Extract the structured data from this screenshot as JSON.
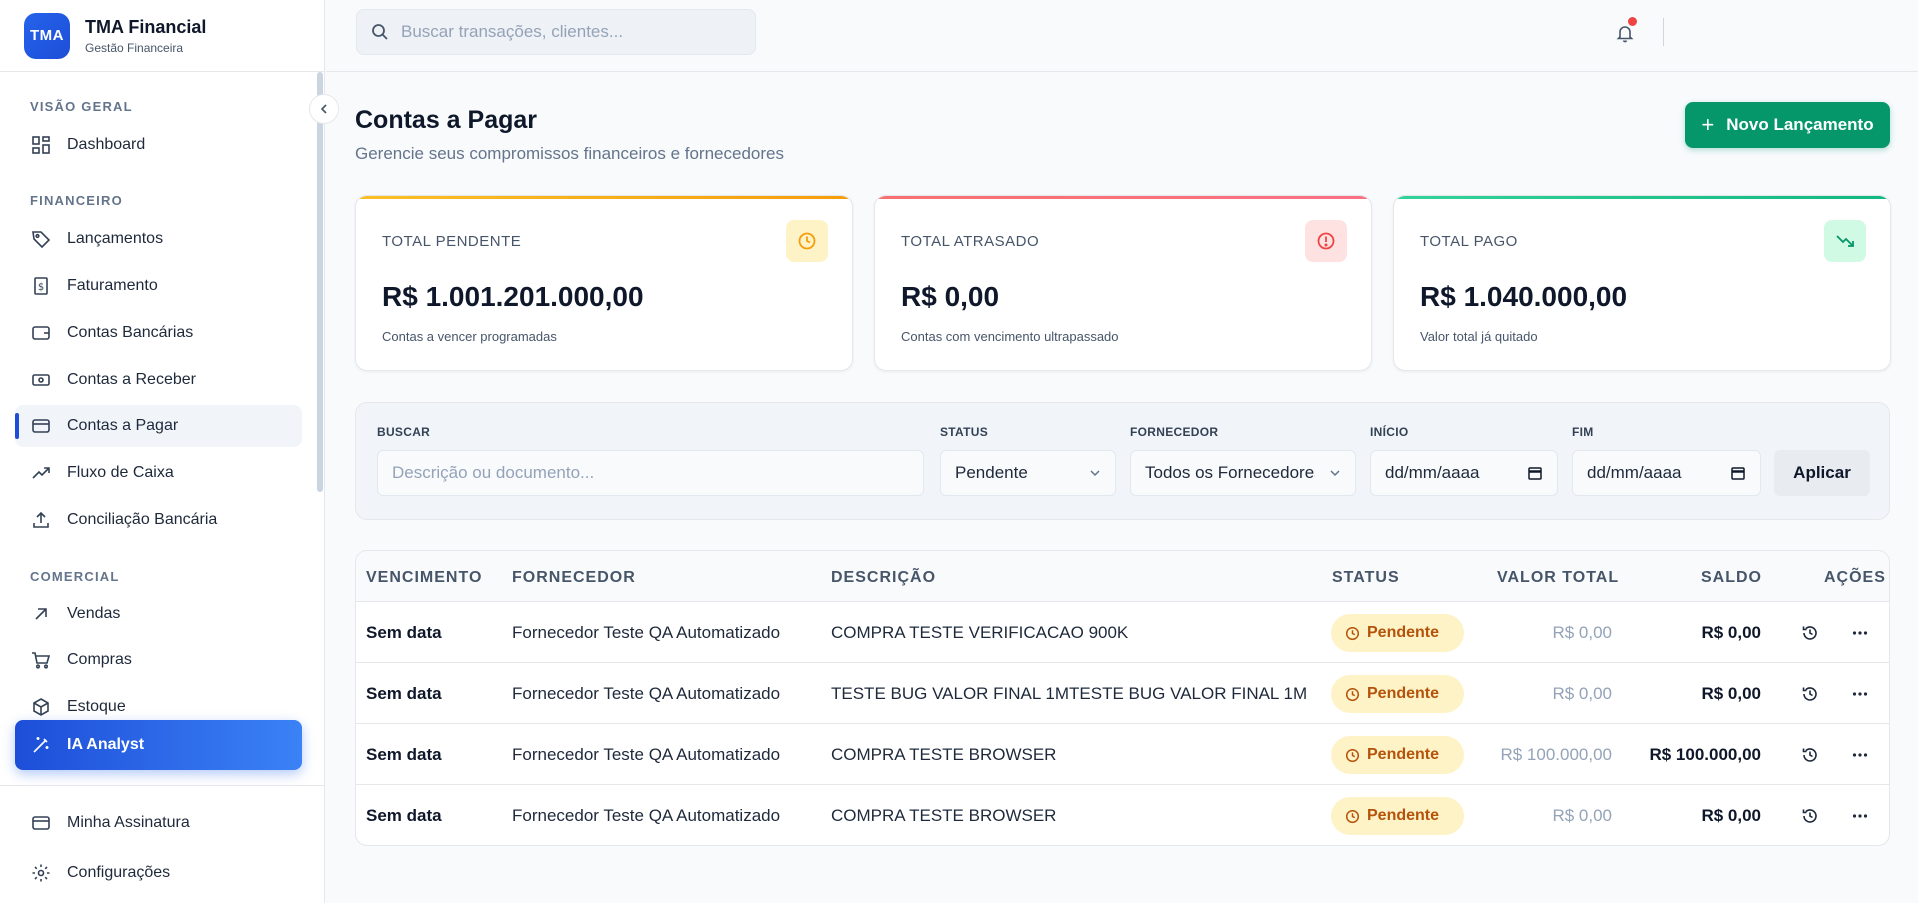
{
  "brand": {
    "logo": "TMA",
    "name": "TMA Financial",
    "subtitle": "Gestão Financeira"
  },
  "sidebar": {
    "sections": [
      {
        "label": "VISÃO GERAL"
      },
      {
        "label": "FINANCEIRO"
      },
      {
        "label": "COMERCIAL"
      }
    ],
    "items": [
      {
        "label": "Dashboard",
        "icon": "dashboard-icon"
      },
      {
        "label": "Lançamentos",
        "icon": "tag-icon"
      },
      {
        "label": "Faturamento",
        "icon": "invoice-icon"
      },
      {
        "label": "Contas Bancárias",
        "icon": "wallet-icon"
      },
      {
        "label": "Contas a Receber",
        "icon": "banknote-icon"
      },
      {
        "label": "Contas a Pagar",
        "icon": "credit-card-icon",
        "active": true
      },
      {
        "label": "Fluxo de Caixa",
        "icon": "trend-up-icon"
      },
      {
        "label": "Conciliação Bancária",
        "icon": "upload-icon"
      },
      {
        "label": "Vendas",
        "icon": "arrow-up-right-icon"
      },
      {
        "label": "Compras",
        "icon": "cart-icon"
      },
      {
        "label": "Estoque",
        "icon": "box-icon"
      },
      {
        "label": "IA Analyst",
        "icon": "magic-wand-icon"
      },
      {
        "label": "Minha Assinatura",
        "icon": "card-icon"
      },
      {
        "label": "Configurações",
        "icon": "gear-icon"
      }
    ]
  },
  "header": {
    "search_placeholder": "Buscar transações, clientes..."
  },
  "page": {
    "title": "Contas a Pagar",
    "subtitle": "Gerencie seus compromissos financeiros e fornecedores",
    "new_button": "Novo Lançamento"
  },
  "cards": [
    {
      "title": "TOTAL PENDENTE",
      "value": "R$ 1.001.201.000,00",
      "desc": "Contas a vencer programadas",
      "color": "#f59e0b"
    },
    {
      "title": "TOTAL ATRASADO",
      "value": "R$ 0,00",
      "desc": "Contas com vencimento ultrapassado",
      "color": "#ef4444"
    },
    {
      "title": "TOTAL PAGO",
      "value": "R$ 1.040.000,00",
      "desc": "Valor total já quitado",
      "color": "#10b981"
    }
  ],
  "filters": {
    "search_label": "BUSCAR",
    "search_placeholder": "Descrição ou documento...",
    "status_label": "STATUS",
    "status_value": "Pendente",
    "supplier_label": "FORNECEDOR",
    "supplier_value": "Todos os Fornecedores",
    "start_label": "INÍCIO",
    "start_value": "dd/mm/aaaa",
    "end_label": "FIM",
    "end_value": "dd/mm/aaaa",
    "apply": "Aplicar"
  },
  "table": {
    "headers": [
      "VENCIMENTO",
      "FORNECEDOR",
      "DESCRIÇÃO",
      "STATUS",
      "VALOR TOTAL",
      "SALDO",
      "AÇÕES"
    ],
    "rows": [
      {
        "due": "Sem data",
        "supplier": "Fornecedor Teste QA Automatizado",
        "description": "COMPRA TESTE VERIFICACAO 900K",
        "status": "Pendente",
        "total": "R$ 0,00",
        "balance": "R$ 0,00"
      },
      {
        "due": "Sem data",
        "supplier": "Fornecedor Teste QA Automatizado",
        "description": "TESTE BUG VALOR FINAL 1MTESTE BUG VALOR FINAL 1M",
        "status": "Pendente",
        "total": "R$ 0,00",
        "balance": "R$ 0,00"
      },
      {
        "due": "Sem data",
        "supplier": "Fornecedor Teste QA Automatizado",
        "description": "COMPRA TESTE BROWSER",
        "status": "Pendente",
        "total": "R$ 100.000,00",
        "balance": "R$ 100.000,00"
      },
      {
        "due": "Sem data",
        "supplier": "Fornecedor Teste QA Automatizado",
        "description": "COMPRA TESTE BROWSER",
        "status": "Pendente",
        "total": "R$ 0,00",
        "balance": "R$ 0,00"
      }
    ]
  }
}
